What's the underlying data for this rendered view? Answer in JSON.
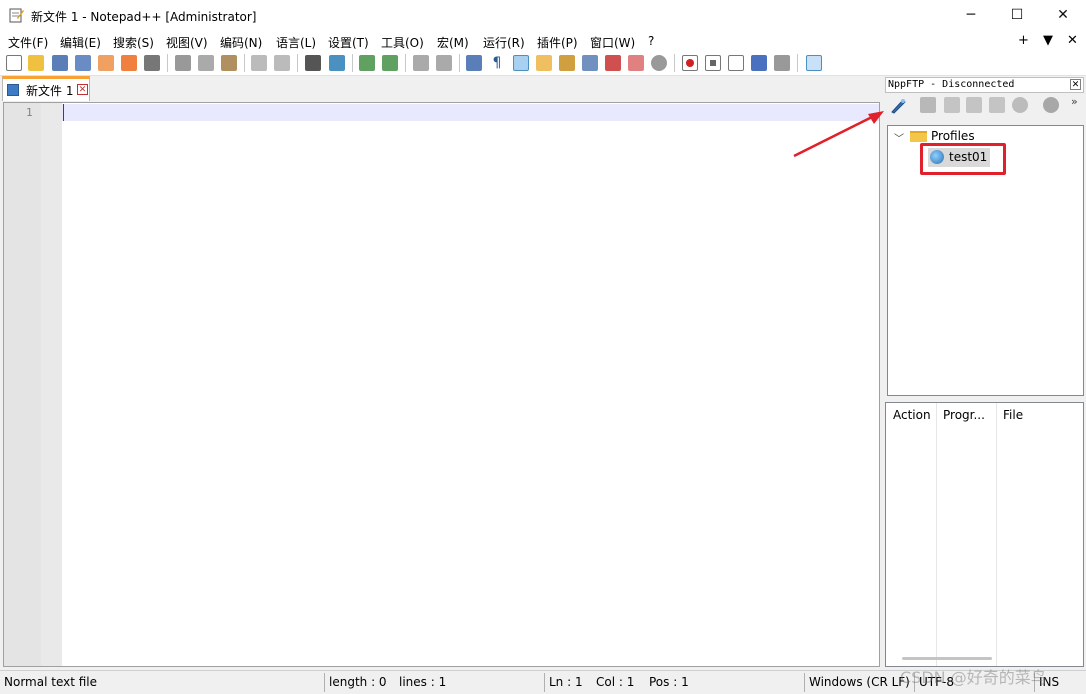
{
  "window": {
    "title": "新文件 1 - Notepad++ [Administrator]",
    "minimize": "─",
    "maximize": "☐",
    "close": "✕"
  },
  "menu": {
    "items": [
      "文件(F)",
      "编辑(E)",
      "搜索(S)",
      "视图(V)",
      "编码(N)",
      "语言(L)",
      "设置(T)",
      "工具(O)",
      "宏(M)",
      "运行(R)",
      "插件(P)",
      "窗口(W)",
      "?"
    ],
    "right": [
      "+",
      "▼",
      "✕"
    ]
  },
  "tab": {
    "label": "新文件 1",
    "close": "✕"
  },
  "editor": {
    "line_number": "1"
  },
  "panel": {
    "title": "NppFTP - Disconnected",
    "close": "✕",
    "more": "»",
    "tree": {
      "root_label": "Profiles",
      "profile_label": "test01"
    },
    "queue_headers": [
      "Action",
      "Progr...",
      "File"
    ]
  },
  "status": {
    "doc_type": "Normal text file",
    "length": "length : 0",
    "lines": "lines : 1",
    "ln": "Ln : 1",
    "col": "Col : 1",
    "pos": "Pos : 1",
    "eol": "Windows (CR LF)",
    "encoding": "UTF-8",
    "mode": "INS"
  },
  "watermark": "CSDN @好奇的菜鸟",
  "colors": {
    "annotation": "#e0202a",
    "tab_accent": "#f7a233",
    "caret": "#8000ff"
  }
}
